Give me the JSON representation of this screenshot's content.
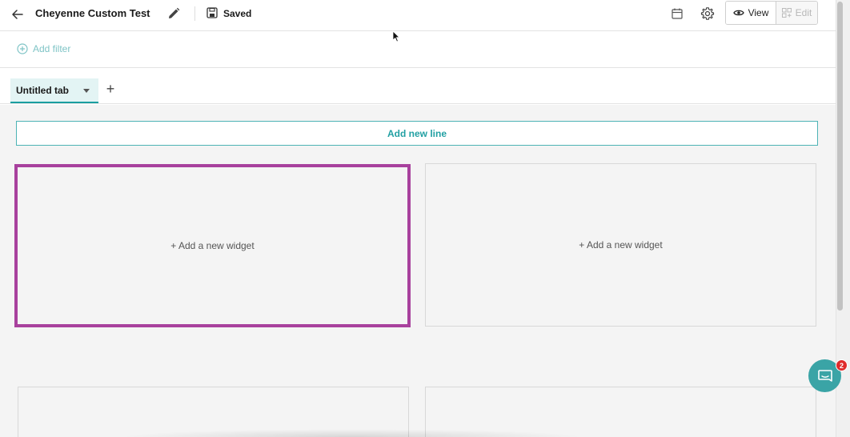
{
  "header": {
    "title": "Cheyenne Custom Test",
    "save_status": "Saved",
    "view_label": "View",
    "edit_label": "Edit",
    "icons": [
      "back-arrow-icon",
      "pencil-icon",
      "save-icon",
      "calendar-icon",
      "gear-icon",
      "eye-icon",
      "grid-icon"
    ]
  },
  "filters": {
    "add_filter_label": "Add filter"
  },
  "tabs": {
    "items": [
      {
        "label": "Untitled tab",
        "active": true
      }
    ],
    "add_tab_label": "+"
  },
  "main": {
    "add_line_label": "Add new line",
    "widgets": [
      {
        "label": "+ Add a new widget",
        "selected": true
      },
      {
        "label": "+ Add a new widget",
        "selected": false
      },
      {
        "label": ""
      },
      {
        "label": ""
      }
    ]
  },
  "chat": {
    "badge_count": "2"
  },
  "colors": {
    "accent": "#1a9ea0",
    "selected_outline": "#a8419d",
    "badge": "#e02b2b",
    "chat_bg": "#3aa4a6"
  }
}
